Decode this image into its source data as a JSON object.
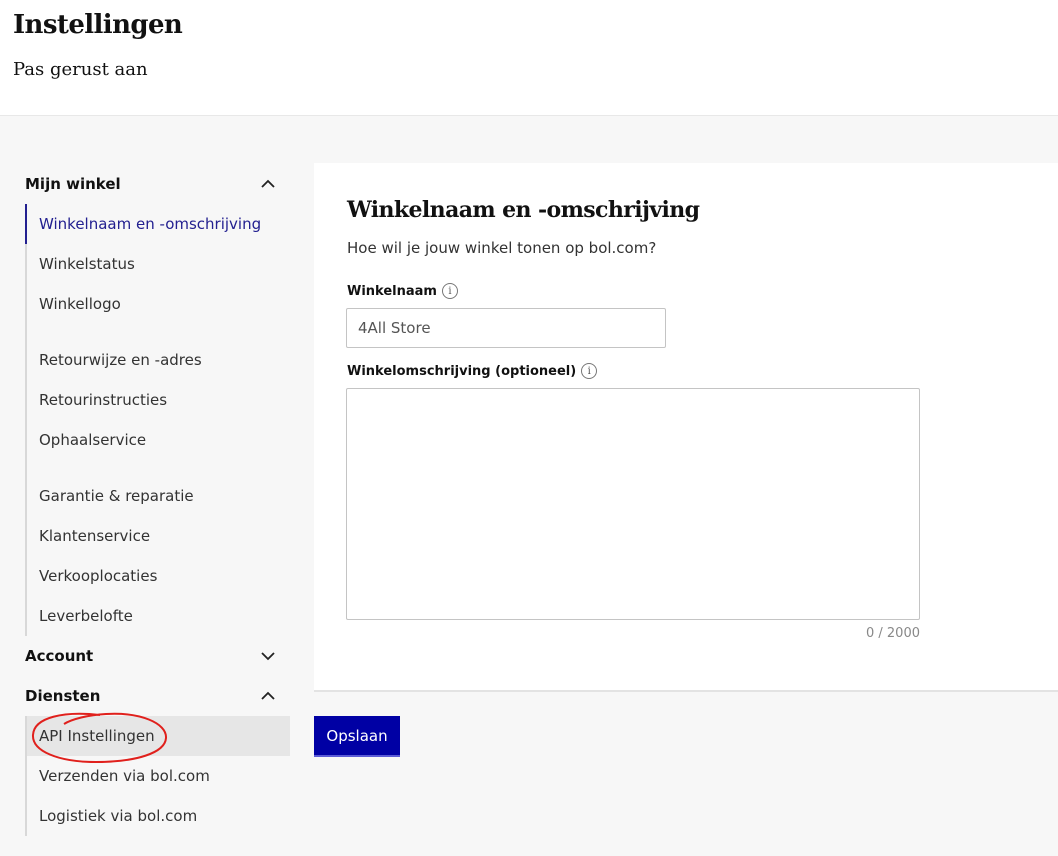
{
  "header": {
    "title": "Instellingen",
    "subtitle": "Pas gerust aan"
  },
  "sidebar": {
    "sections": [
      {
        "label": "Mijn winkel",
        "expanded": true,
        "chevron_icon": "chevron-up-icon",
        "items": [
          "Winkelnaam en -omschrijving",
          "Winkelstatus",
          "Winkellogo",
          "Retourwijze en -adres",
          "Retourinstructies",
          "Ophaalservice",
          "Garantie & reparatie",
          "Klantenservice",
          "Verkooplocaties",
          "Leverbelofte"
        ],
        "active_item": "Winkelnaam en -omschrijving"
      },
      {
        "label": "Account",
        "expanded": false,
        "chevron_icon": "chevron-down-icon"
      },
      {
        "label": "Diensten",
        "expanded": true,
        "chevron_icon": "chevron-up-icon",
        "items": [
          "API Instellingen",
          "Verzenden via bol.com",
          "Logistiek via bol.com"
        ],
        "highlighted_item": "API Instellingen"
      }
    ]
  },
  "form": {
    "title": "Winkelnaam en -omschrijving",
    "subtitle": "Hoe wil je jouw winkel tonen op bol.com?",
    "name_label": "Winkelnaam",
    "name_value": "4All Store",
    "description_label": "Winkelomschrijving (optioneel)",
    "description_value": "",
    "char_counter": "0 / 2000",
    "info_icon": "info-icon"
  },
  "actions": {
    "save_label": "Opslaan"
  },
  "colors": {
    "primary": "#0000a4",
    "active_nav": "#232090",
    "annotation": "#e0201c",
    "background": "#f7f7f7"
  }
}
